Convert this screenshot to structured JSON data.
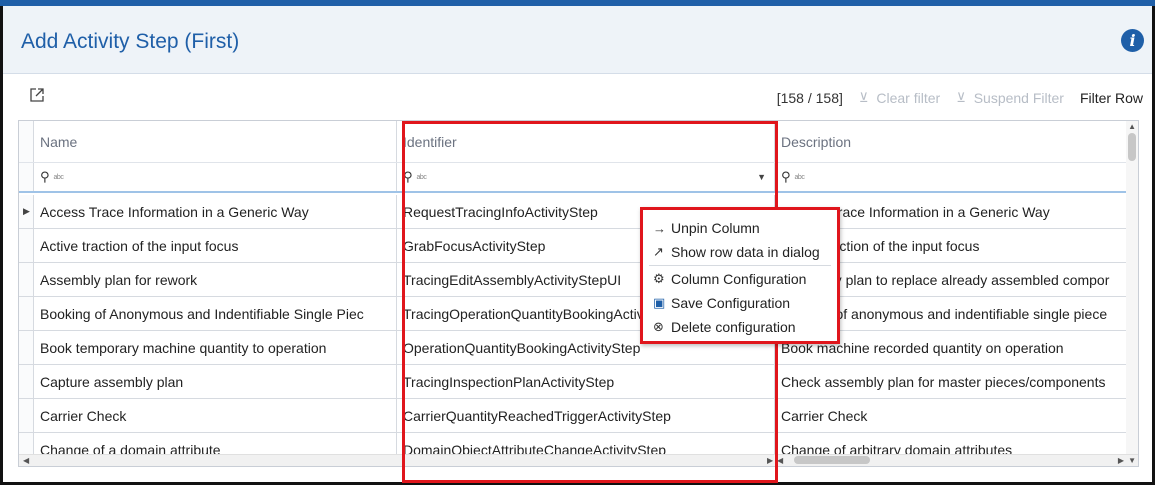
{
  "title": "Add Activity Step (First)",
  "toolbar": {
    "count": "[158 / 158]",
    "clear_filter": "Clear filter",
    "suspend_filter": "Suspend Filter",
    "filter_row": "Filter Row"
  },
  "columns": {
    "name": "Name",
    "identifier": "Identifier",
    "description": "Description"
  },
  "filter": {
    "type_label": "abc"
  },
  "rows": [
    {
      "name": "Access Trace Information in a Generic Way",
      "identifier": "RequestTracingInfoActivityStep",
      "description": "Access Trace Information in a Generic Way"
    },
    {
      "name": "Active traction of the input focus",
      "identifier": "GrabFocusActivityStep",
      "description": "Active traction of the input focus"
    },
    {
      "name": "Assembly plan for rework",
      "identifier": "TracingEditAssemblyActivityStepUI",
      "description": "Assembly plan to replace already assembled compor"
    },
    {
      "name": "Booking of Anonymous and Indentifiable Single Piec",
      "identifier": "TracingOperationQuantityBookingActivityStep",
      "description": "Booking of anonymous and indentifiable single piece"
    },
    {
      "name": "Book temporary machine quantity to operation",
      "identifier": "OperationQuantityBookingActivityStep",
      "description": "Book machine recorded quantity on operation"
    },
    {
      "name": "Capture assembly plan",
      "identifier": "TracingInspectionPlanActivityStep",
      "description": "Check assembly plan for master pieces/components"
    },
    {
      "name": "Carrier Check",
      "identifier": "CarrierQuantityReachedTriggerActivityStep",
      "description": "Carrier Check"
    },
    {
      "name": "Change of a domain attribute",
      "identifier": "DomainObjectAttributeChangeActivityStep",
      "description": "Change of arbitrary domain attributes"
    }
  ],
  "context_menu": {
    "unpin": "Unpin Column",
    "show_row": "Show row data in dialog",
    "column_config": "Column Configuration",
    "save_config": "Save Configuration",
    "delete_config": "Delete configuration"
  },
  "colors": {
    "accent": "#1f5fa8",
    "highlight": "#e0161c"
  },
  "icons": [
    "info-icon",
    "export-icon",
    "funnel-icon",
    "search-icon",
    "unpin-icon",
    "dialog-icon",
    "gear-icon",
    "save-icon",
    "delete-icon"
  ]
}
